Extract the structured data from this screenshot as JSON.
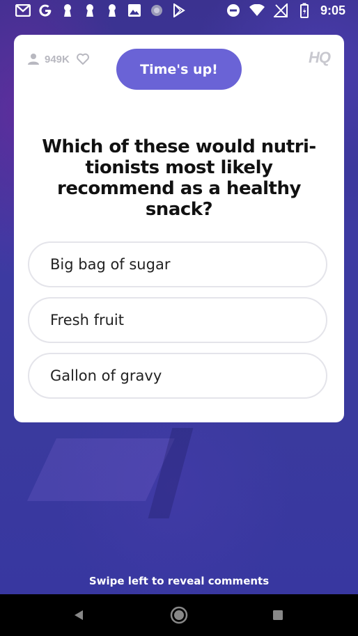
{
  "status_bar": {
    "time": "9:05",
    "left_icons": [
      "gmail-icon",
      "google-icon",
      "keyhole-icon",
      "keyhole-icon",
      "keyhole-icon",
      "image-icon",
      "circle-icon",
      "play-store-icon"
    ],
    "right_icons": [
      "do-not-disturb-icon",
      "wifi-icon",
      "no-signal-icon",
      "battery-charging-icon"
    ]
  },
  "card": {
    "viewer_count": "949K",
    "timer_label": "Time's up!",
    "logo_text": "HQ",
    "question": "Which of these would nutri-tionists most likely recommend as a healthy snack?",
    "answers": [
      "Big bag of sugar",
      "Fresh fruit",
      "Gallon of gravy"
    ]
  },
  "footer": {
    "swipe_hint": "Swipe left to reveal comments"
  },
  "nav_bar": {
    "buttons": [
      "back-icon",
      "home-icon",
      "recent-apps-icon"
    ]
  },
  "colors": {
    "accent": "#6a63d6",
    "background": "#3a3494",
    "card": "#ffffff"
  }
}
